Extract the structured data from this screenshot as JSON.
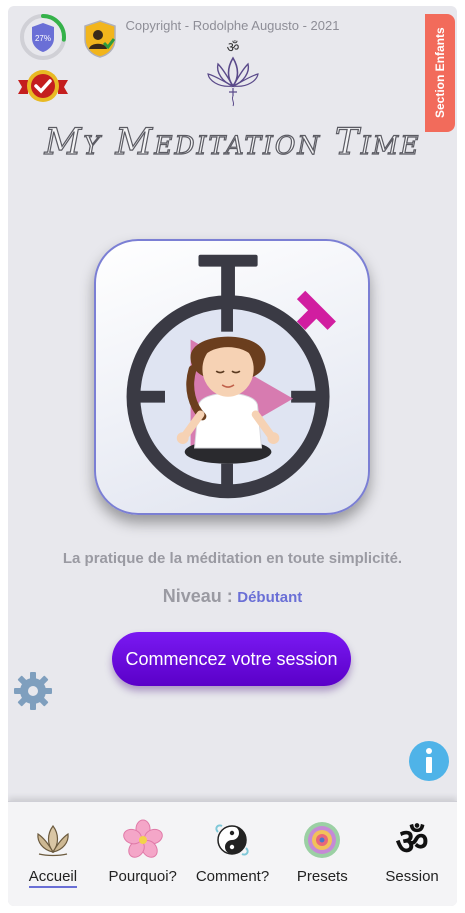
{
  "header": {
    "copyright": "Copyright - Rodolphe Augusto - 2021",
    "progress_percent": "27%",
    "progress_value": 0.27,
    "kids_tab_label": "Section Enfants"
  },
  "app": {
    "title": "My Meditation Time"
  },
  "hero": {
    "tagline": "La pratique de la méditation en toute simplicité.",
    "level_label": "Niveau :",
    "level_value": "Débutant"
  },
  "actions": {
    "start_label": "Commencez votre session"
  },
  "nav": {
    "items": [
      {
        "label": "Accueil",
        "icon": "lotus-icon"
      },
      {
        "label": "Pourquoi?",
        "icon": "flower-icon"
      },
      {
        "label": "Comment?",
        "icon": "yin-yang-icon"
      },
      {
        "label": "Presets",
        "icon": "mandala-icon"
      },
      {
        "label": "Session",
        "icon": "om-icon"
      }
    ]
  },
  "colors": {
    "accent": "#6a6fd6",
    "button": "#6a0ee0",
    "kids_tab": "#f26b5b",
    "info": "#4fb3e8"
  }
}
